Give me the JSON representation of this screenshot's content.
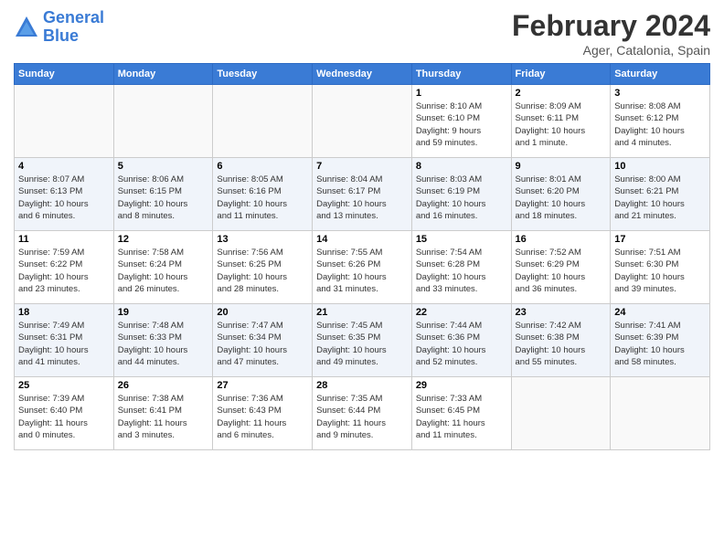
{
  "logo": {
    "line1": "General",
    "line2": "Blue"
  },
  "title": "February 2024",
  "location": "Ager, Catalonia, Spain",
  "days_of_week": [
    "Sunday",
    "Monday",
    "Tuesday",
    "Wednesday",
    "Thursday",
    "Friday",
    "Saturday"
  ],
  "weeks": [
    {
      "shade": "white",
      "days": [
        {
          "num": "",
          "info": ""
        },
        {
          "num": "",
          "info": ""
        },
        {
          "num": "",
          "info": ""
        },
        {
          "num": "",
          "info": ""
        },
        {
          "num": "1",
          "info": "Sunrise: 8:10 AM\nSunset: 6:10 PM\nDaylight: 9 hours\nand 59 minutes."
        },
        {
          "num": "2",
          "info": "Sunrise: 8:09 AM\nSunset: 6:11 PM\nDaylight: 10 hours\nand 1 minute."
        },
        {
          "num": "3",
          "info": "Sunrise: 8:08 AM\nSunset: 6:12 PM\nDaylight: 10 hours\nand 4 minutes."
        }
      ]
    },
    {
      "shade": "shade",
      "days": [
        {
          "num": "4",
          "info": "Sunrise: 8:07 AM\nSunset: 6:13 PM\nDaylight: 10 hours\nand 6 minutes."
        },
        {
          "num": "5",
          "info": "Sunrise: 8:06 AM\nSunset: 6:15 PM\nDaylight: 10 hours\nand 8 minutes."
        },
        {
          "num": "6",
          "info": "Sunrise: 8:05 AM\nSunset: 6:16 PM\nDaylight: 10 hours\nand 11 minutes."
        },
        {
          "num": "7",
          "info": "Sunrise: 8:04 AM\nSunset: 6:17 PM\nDaylight: 10 hours\nand 13 minutes."
        },
        {
          "num": "8",
          "info": "Sunrise: 8:03 AM\nSunset: 6:19 PM\nDaylight: 10 hours\nand 16 minutes."
        },
        {
          "num": "9",
          "info": "Sunrise: 8:01 AM\nSunset: 6:20 PM\nDaylight: 10 hours\nand 18 minutes."
        },
        {
          "num": "10",
          "info": "Sunrise: 8:00 AM\nSunset: 6:21 PM\nDaylight: 10 hours\nand 21 minutes."
        }
      ]
    },
    {
      "shade": "white",
      "days": [
        {
          "num": "11",
          "info": "Sunrise: 7:59 AM\nSunset: 6:22 PM\nDaylight: 10 hours\nand 23 minutes."
        },
        {
          "num": "12",
          "info": "Sunrise: 7:58 AM\nSunset: 6:24 PM\nDaylight: 10 hours\nand 26 minutes."
        },
        {
          "num": "13",
          "info": "Sunrise: 7:56 AM\nSunset: 6:25 PM\nDaylight: 10 hours\nand 28 minutes."
        },
        {
          "num": "14",
          "info": "Sunrise: 7:55 AM\nSunset: 6:26 PM\nDaylight: 10 hours\nand 31 minutes."
        },
        {
          "num": "15",
          "info": "Sunrise: 7:54 AM\nSunset: 6:28 PM\nDaylight: 10 hours\nand 33 minutes."
        },
        {
          "num": "16",
          "info": "Sunrise: 7:52 AM\nSunset: 6:29 PM\nDaylight: 10 hours\nand 36 minutes."
        },
        {
          "num": "17",
          "info": "Sunrise: 7:51 AM\nSunset: 6:30 PM\nDaylight: 10 hours\nand 39 minutes."
        }
      ]
    },
    {
      "shade": "shade",
      "days": [
        {
          "num": "18",
          "info": "Sunrise: 7:49 AM\nSunset: 6:31 PM\nDaylight: 10 hours\nand 41 minutes."
        },
        {
          "num": "19",
          "info": "Sunrise: 7:48 AM\nSunset: 6:33 PM\nDaylight: 10 hours\nand 44 minutes."
        },
        {
          "num": "20",
          "info": "Sunrise: 7:47 AM\nSunset: 6:34 PM\nDaylight: 10 hours\nand 47 minutes."
        },
        {
          "num": "21",
          "info": "Sunrise: 7:45 AM\nSunset: 6:35 PM\nDaylight: 10 hours\nand 49 minutes."
        },
        {
          "num": "22",
          "info": "Sunrise: 7:44 AM\nSunset: 6:36 PM\nDaylight: 10 hours\nand 52 minutes."
        },
        {
          "num": "23",
          "info": "Sunrise: 7:42 AM\nSunset: 6:38 PM\nDaylight: 10 hours\nand 55 minutes."
        },
        {
          "num": "24",
          "info": "Sunrise: 7:41 AM\nSunset: 6:39 PM\nDaylight: 10 hours\nand 58 minutes."
        }
      ]
    },
    {
      "shade": "white",
      "days": [
        {
          "num": "25",
          "info": "Sunrise: 7:39 AM\nSunset: 6:40 PM\nDaylight: 11 hours\nand 0 minutes."
        },
        {
          "num": "26",
          "info": "Sunrise: 7:38 AM\nSunset: 6:41 PM\nDaylight: 11 hours\nand 3 minutes."
        },
        {
          "num": "27",
          "info": "Sunrise: 7:36 AM\nSunset: 6:43 PM\nDaylight: 11 hours\nand 6 minutes."
        },
        {
          "num": "28",
          "info": "Sunrise: 7:35 AM\nSunset: 6:44 PM\nDaylight: 11 hours\nand 9 minutes."
        },
        {
          "num": "29",
          "info": "Sunrise: 7:33 AM\nSunset: 6:45 PM\nDaylight: 11 hours\nand 11 minutes."
        },
        {
          "num": "",
          "info": ""
        },
        {
          "num": "",
          "info": ""
        }
      ]
    }
  ]
}
